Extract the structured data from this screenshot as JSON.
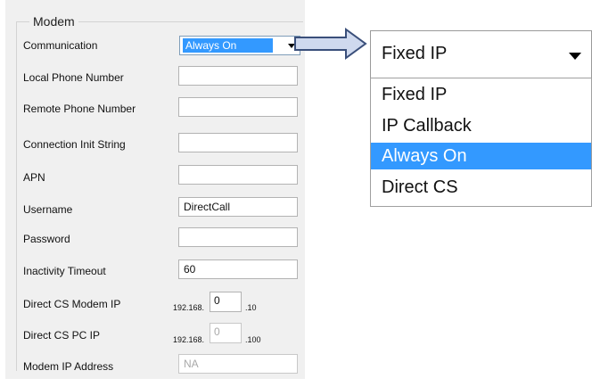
{
  "group": {
    "legend": "Modem"
  },
  "fields": {
    "communication": {
      "label": "Communication",
      "value": "Always On"
    },
    "local_phone": {
      "label": "Local Phone Number",
      "value": ""
    },
    "remote_phone": {
      "label": "Remote Phone Number",
      "value": ""
    },
    "init_string": {
      "label": "Connection Init String",
      "value": ""
    },
    "apn": {
      "label": "APN",
      "value": ""
    },
    "username": {
      "label": "Username",
      "value": "DirectCall"
    },
    "password": {
      "label": "Password",
      "value": ""
    },
    "inactivity": {
      "label": "Inactivity Timeout",
      "value": "60"
    },
    "direct_modem_ip": {
      "label": "Direct CS Modem IP",
      "prefix": "192.168.",
      "octet": "0",
      "suffix": ".10"
    },
    "direct_pc_ip": {
      "label": "Direct CS PC IP",
      "prefix": "192.168.",
      "octet": "0",
      "suffix": ".100"
    },
    "modem_ip": {
      "label": "Modem IP Address",
      "value": "NA"
    }
  },
  "zoom_dropdown": {
    "value": "Fixed IP",
    "options": [
      "Fixed IP",
      "IP Callback",
      "Always On",
      "Direct CS"
    ],
    "highlighted": "Always On"
  },
  "colors": {
    "highlight": "#3399ff",
    "arrow_fill": "#cfd9ee",
    "arrow_stroke": "#3a4f7a"
  }
}
